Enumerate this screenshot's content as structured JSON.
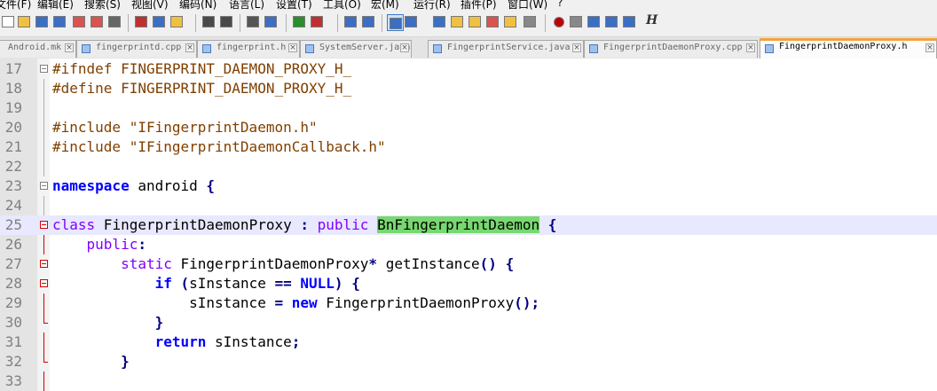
{
  "menu": [
    "文件(F)",
    "编辑(E)",
    "搜索(S)",
    "视图(V)",
    "编码(N)",
    "语言(L)",
    "设置(T)",
    "工具(O)",
    "宏(M)",
    "运行(R)",
    "插件(P)",
    "窗口(W)",
    "?"
  ],
  "toolbar": {
    "icons": [
      "new-file-icon",
      "open-file-icon",
      "save-icon",
      "save-all-icon",
      "close-icon",
      "close-all-icon",
      "print-icon",
      "cut-icon",
      "copy-icon",
      "paste-icon",
      "undo-icon",
      "redo-icon",
      "find-icon",
      "replace-icon",
      "zoom-in-icon",
      "zoom-out-icon",
      "sync-vertical-icon",
      "sync-horizontal-icon",
      "word-wrap-icon",
      "show-all-chars-icon",
      "indent-guide-icon",
      "language-icon",
      "doc-map-icon",
      "function-list-icon",
      "folder-workspace-icon",
      "monitor-icon",
      "record-macro-icon",
      "stop-macro-icon",
      "play-macro-icon",
      "run-macro-multiple-icon",
      "save-macro-icon",
      "hex-editor-icon"
    ],
    "hex_label": "H"
  },
  "tabs": [
    {
      "label": "Android.mk",
      "active": false,
      "icon": "file-plain-icon"
    },
    {
      "label": "fingerprintd.cpp",
      "active": false,
      "icon": "file-icon"
    },
    {
      "label": "fingerprint.h",
      "active": false,
      "icon": "file-icon"
    },
    {
      "label": "SystemServer.java",
      "active": false,
      "icon": "file-icon"
    },
    {
      "label": "FingerprintService.java",
      "active": false,
      "icon": "file-icon"
    },
    {
      "label": "FingerprintDaemonProxy.cpp",
      "active": false,
      "icon": "file-icon"
    },
    {
      "label": "FingerprintDaemonProxy.h",
      "active": true,
      "icon": "file-icon"
    }
  ],
  "editor": {
    "lines": [
      {
        "num": "17",
        "parts": [
          [
            "pre",
            "#ifndef FINGERPRINT_DAEMON_PROXY_H_"
          ]
        ]
      },
      {
        "num": "18",
        "parts": [
          [
            "pre",
            "#define FINGERPRINT_DAEMON_PROXY_H_"
          ]
        ]
      },
      {
        "num": "19",
        "parts": []
      },
      {
        "num": "20",
        "parts": [
          [
            "pre",
            "#include \"IFingerprintDaemon.h\""
          ]
        ]
      },
      {
        "num": "21",
        "parts": [
          [
            "pre",
            "#include \"IFingerprintDaemonCallback.h\""
          ]
        ]
      },
      {
        "num": "22",
        "parts": []
      },
      {
        "num": "23",
        "parts": [
          [
            "kw",
            "namespace"
          ],
          [
            "plain",
            " android "
          ],
          [
            "op",
            "{"
          ]
        ]
      },
      {
        "num": "24",
        "parts": []
      },
      {
        "num": "25",
        "parts": [
          [
            "type",
            "class"
          ],
          [
            "plain",
            " FingerprintDaemonProxy "
          ],
          [
            "op",
            ":"
          ],
          [
            "plain",
            " "
          ],
          [
            "type",
            "public"
          ],
          [
            "plain",
            " "
          ],
          [
            "hl",
            "BnFingerprintDaemon"
          ],
          [
            "plain",
            " "
          ],
          [
            "op",
            "{"
          ]
        ]
      },
      {
        "num": "26",
        "parts": [
          [
            "plain",
            "    "
          ],
          [
            "type",
            "public"
          ],
          [
            "op",
            ":"
          ]
        ]
      },
      {
        "num": "27",
        "parts": [
          [
            "plain",
            "        "
          ],
          [
            "type",
            "static"
          ],
          [
            "plain",
            " FingerprintDaemonProxy"
          ],
          [
            "op",
            "*"
          ],
          [
            "plain",
            " getInstance"
          ],
          [
            "op",
            "()"
          ],
          [
            "plain",
            " "
          ],
          [
            "op",
            "{"
          ]
        ]
      },
      {
        "num": "28",
        "parts": [
          [
            "plain",
            "            "
          ],
          [
            "kw",
            "if"
          ],
          [
            "plain",
            " "
          ],
          [
            "op",
            "("
          ],
          [
            "plain",
            "sInstance "
          ],
          [
            "op",
            "=="
          ],
          [
            "plain",
            " "
          ],
          [
            "kw",
            "NULL"
          ],
          [
            "op",
            ")"
          ],
          [
            "plain",
            " "
          ],
          [
            "op",
            "{"
          ]
        ]
      },
      {
        "num": "29",
        "parts": [
          [
            "plain",
            "                sInstance "
          ],
          [
            "op",
            "="
          ],
          [
            "plain",
            " "
          ],
          [
            "kw",
            "new"
          ],
          [
            "plain",
            " FingerprintDaemonProxy"
          ],
          [
            "op",
            "();"
          ]
        ]
      },
      {
        "num": "30",
        "parts": [
          [
            "plain",
            "            "
          ],
          [
            "op",
            "}"
          ]
        ]
      },
      {
        "num": "31",
        "parts": [
          [
            "plain",
            "            "
          ],
          [
            "kw",
            "return"
          ],
          [
            "plain",
            " sInstance"
          ],
          [
            "op",
            ";"
          ]
        ]
      },
      {
        "num": "32",
        "parts": [
          [
            "plain",
            "        "
          ],
          [
            "op",
            "}"
          ]
        ]
      },
      {
        "num": "33",
        "parts": []
      }
    ]
  },
  "colors": {
    "preprocessor": "#804000",
    "keyword": "#0000ff",
    "type": "#8000ff",
    "operator": "#000080",
    "match_highlight": "#78d870",
    "current_line": "#e8e8ff",
    "active_tab_accent": "#f3a33a"
  }
}
